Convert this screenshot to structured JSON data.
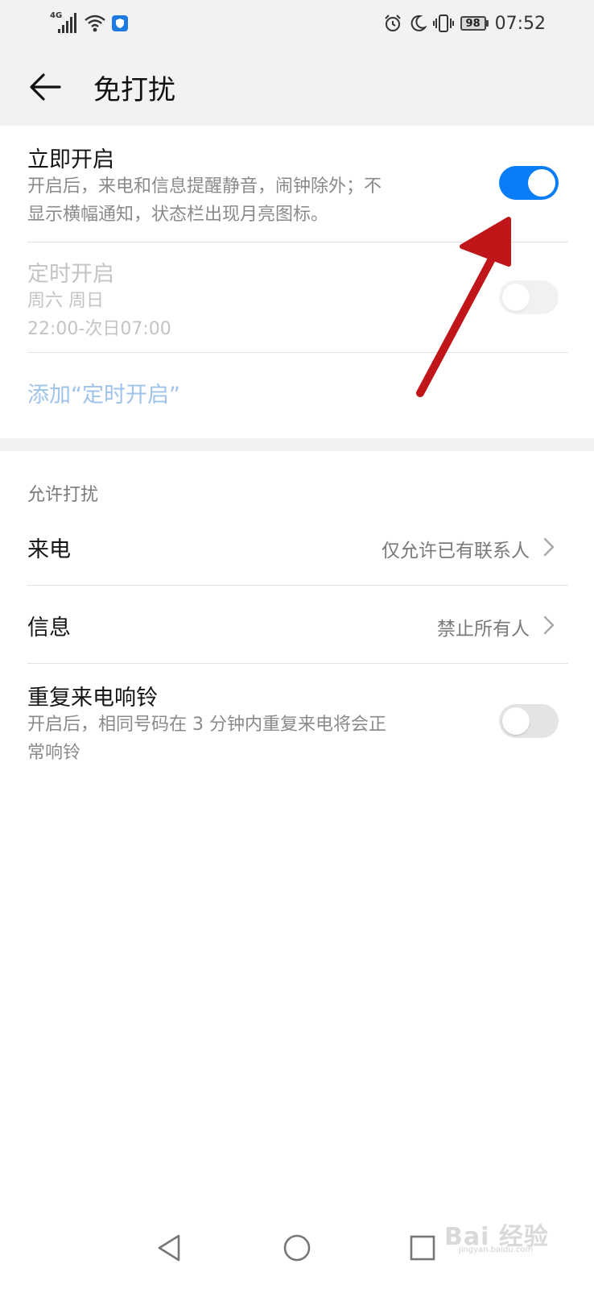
{
  "status_bar": {
    "network_label": "4G",
    "battery_level": "98",
    "time": "07:52"
  },
  "header": {
    "title": "免打扰"
  },
  "immediate": {
    "title": "立即开启",
    "description_line1": "开启后，来电和信息提醒静音，闹钟除外；不",
    "description_line2": "显示横幅通知，状态栏出现月亮图标。",
    "enabled": true
  },
  "scheduled": {
    "title": "定时开启",
    "days": "周六 周日",
    "time_range": "22:00-次日07:00",
    "enabled": false
  },
  "add_schedule": {
    "label": "添加“定时开启”"
  },
  "allow_section": {
    "header": "允许打扰",
    "calls": {
      "label": "来电",
      "value": "仅允许已有联系人"
    },
    "messages": {
      "label": "信息",
      "value": "禁止所有人"
    },
    "repeat_calls": {
      "title": "重复来电响铃",
      "description_line1": "开启后，相同号码在 3 分钟内重复来电将会正",
      "description_line2": "常响铃",
      "enabled": false
    }
  },
  "watermark": {
    "text": "Bai 经验",
    "sub": "jingyan.baidu.com"
  },
  "colors": {
    "accent": "#0a7cf5",
    "annotation_arrow": "#c0161a",
    "header_bg": "#f2f2f4"
  }
}
